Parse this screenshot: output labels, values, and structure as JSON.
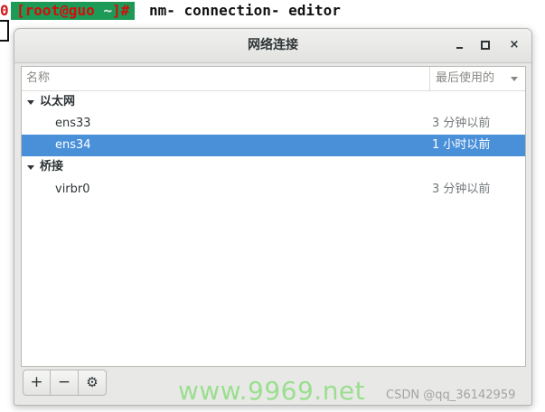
{
  "terminal": {
    "left_digit": "0",
    "prompt_open": "[",
    "prompt_user_host": "root@guo",
    "prompt_path": " ~",
    "prompt_close": "]#",
    "command": "nm- connection- editor"
  },
  "window": {
    "title": "网络连接",
    "controls": {
      "minimize": "minimize",
      "maximize": "maximize",
      "close": "×"
    }
  },
  "list": {
    "header": {
      "name_col": "名称",
      "last_used_col": "最后使用的"
    },
    "groups": [
      {
        "label": "以太网",
        "connections": [
          {
            "name": "ens33",
            "last_used": "3 分钟以前",
            "selected": false
          },
          {
            "name": "ens34",
            "last_used": "1 小时以前",
            "selected": true
          }
        ]
      },
      {
        "label": "桥接",
        "connections": [
          {
            "name": "virbr0",
            "last_used": "3 分钟以前",
            "selected": false
          }
        ]
      }
    ]
  },
  "toolbar": {
    "add_label": "+",
    "remove_label": "−",
    "settings_label": "⚙"
  },
  "watermarks": {
    "main": "www.9969.net",
    "csdn": "CSDN @qq_36142959"
  },
  "colors": {
    "selection": "#4a90d9",
    "prompt_bg": "#1d9a56",
    "prompt_fg": "#d60c0c"
  }
}
